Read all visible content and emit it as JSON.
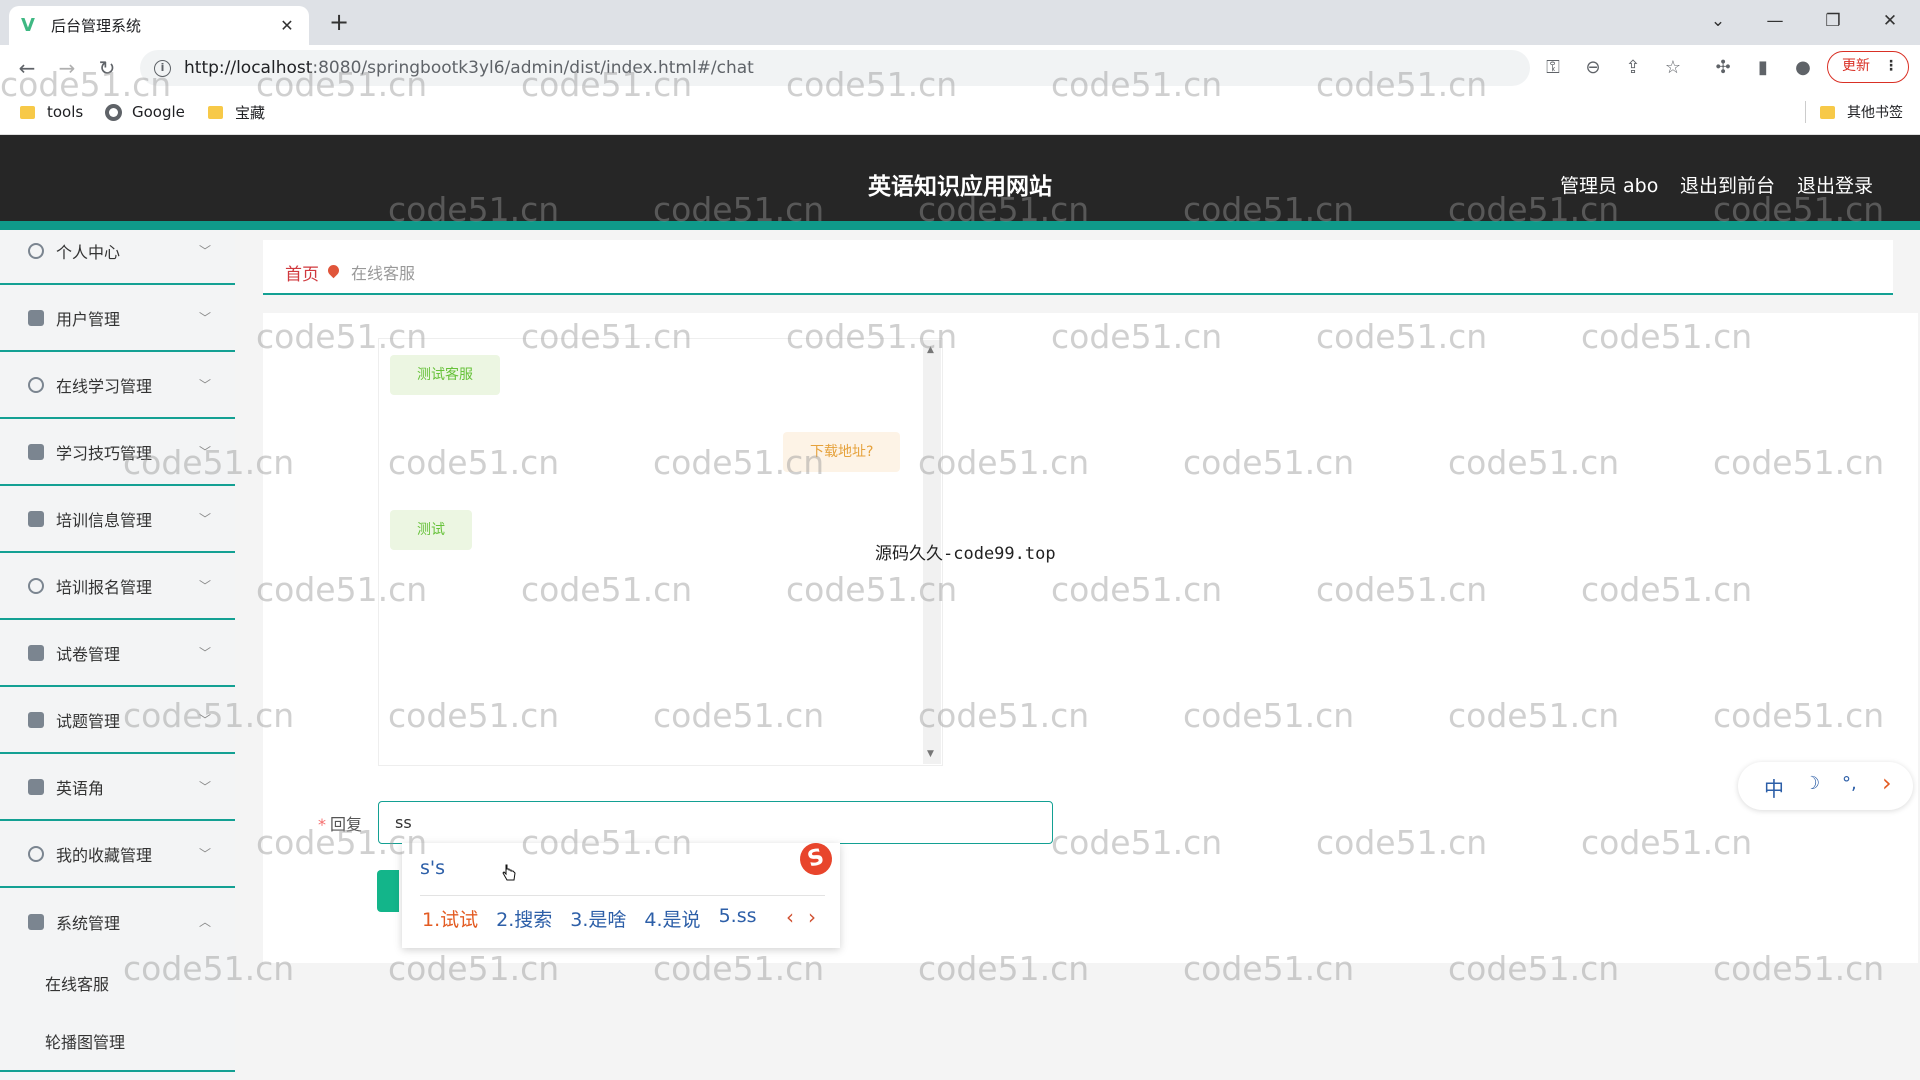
{
  "browser": {
    "tab_title": "后台管理系统",
    "tab_logo": "V",
    "url_host": "http://localhost",
    "url_path": ":8080/springbootk3yl6/admin/dist/index.html#/chat",
    "update_label": "更新",
    "bookmarks": [
      "tools",
      "Google",
      "宝藏"
    ],
    "other_bookmarks": "其他书签"
  },
  "header": {
    "title": "英语知识应用网站",
    "user": "管理员 abo",
    "to_front": "退出到前台",
    "logout": "退出登录"
  },
  "sidebar": {
    "items": [
      {
        "label": "个人中心"
      },
      {
        "label": "用户管理"
      },
      {
        "label": "在线学习管理"
      },
      {
        "label": "学习技巧管理"
      },
      {
        "label": "培训信息管理"
      },
      {
        "label": "培训报名管理"
      },
      {
        "label": "试卷管理"
      },
      {
        "label": "试题管理"
      },
      {
        "label": "英语角"
      },
      {
        "label": "我的收藏管理"
      },
      {
        "label": "系统管理"
      }
    ],
    "sub_items": [
      {
        "label": "在线客服"
      },
      {
        "label": "轮播图管理"
      }
    ]
  },
  "breadcrumb": {
    "home": "首页",
    "current": "在线客服"
  },
  "chat": {
    "messages": [
      {
        "side": "left",
        "text": "测试客服"
      },
      {
        "side": "right",
        "text": "下载地址?"
      },
      {
        "side": "left",
        "text": "测试"
      }
    ]
  },
  "credit_text": "源码久久-code99.top",
  "reply": {
    "label": "回复",
    "value": "ss"
  },
  "ime": {
    "composition": "s's",
    "candidates": [
      "1.试试",
      "2.搜索",
      "3.是啥",
      "4.是说",
      "5.ss"
    ],
    "prev": "‹",
    "next": "›",
    "logo": "S",
    "status": [
      "中",
      "☽",
      "°,",
      "›"
    ]
  },
  "watermark": "code51.cn",
  "colors": {
    "accent": "#13a093",
    "header_bg": "#262626",
    "breadcrumb_home": "#d0393e"
  }
}
